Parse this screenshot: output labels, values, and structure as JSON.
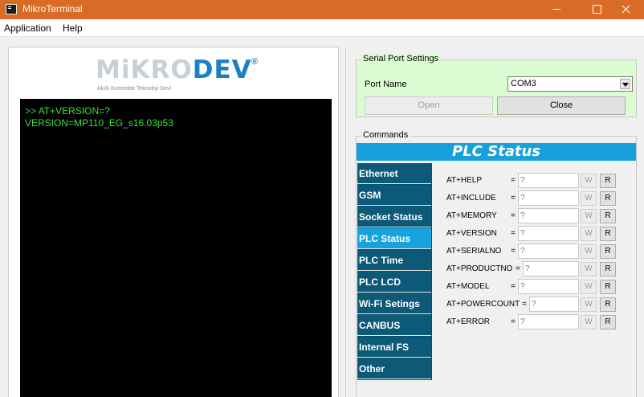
{
  "window": {
    "title": "MikroTerminal"
  },
  "menubar": {
    "items": [
      "Application",
      "Help"
    ]
  },
  "logo": {
    "brand_prefix": "MiKRO",
    "brand_suffix": "DEV",
    "registered": "®",
    "tagline": "Akıllı Kontrolde Teknoloji Devi"
  },
  "console": {
    "lines": [
      ">> AT+VERSION=?",
      "VERSION=MP110_EG_s16.03p53"
    ]
  },
  "serial": {
    "group_title": "Serial Port Settings",
    "port_label": "Port Name",
    "port_value": "COM3",
    "open_label": "Open",
    "close_label": "Close"
  },
  "commands": {
    "group_title": "Commands",
    "banner": "PLC Status",
    "nav": [
      "Ethernet",
      "GSM",
      "Socket Status",
      "PLC Status",
      "PLC Time",
      "PLC LCD",
      "Wi-Fi Setings",
      "CANBUS",
      "Internal FS",
      "Other"
    ],
    "active_nav": "PLC Status",
    "rows": [
      {
        "label": "AT+HELP",
        "eq": "=",
        "placeholder": "?",
        "w": "W",
        "r": "R"
      },
      {
        "label": "AT+INCLUDE",
        "eq": "=",
        "placeholder": "?",
        "w": "W",
        "r": "R"
      },
      {
        "label": "AT+MEMORY",
        "eq": "=",
        "placeholder": "?",
        "w": "W",
        "r": "R"
      },
      {
        "label": "AT+VERSION",
        "eq": "=",
        "placeholder": "?",
        "w": "W",
        "r": "R"
      },
      {
        "label": "AT+SERIALNO",
        "eq": "=",
        "placeholder": "?",
        "w": "W",
        "r": "R"
      },
      {
        "label": "AT+PRODUCTNO",
        "eq": "=",
        "placeholder": "?",
        "w": "W",
        "r": "R"
      },
      {
        "label": "AT+MODEL",
        "eq": "=",
        "placeholder": "?",
        "w": "W",
        "r": "R"
      },
      {
        "label": "AT+POWERCOUNT",
        "eq": "=",
        "placeholder": "?",
        "w": "W",
        "r": "R"
      },
      {
        "label": "AT+ERROR",
        "eq": "=",
        "placeholder": "?",
        "w": "W",
        "r": "R"
      }
    ]
  }
}
